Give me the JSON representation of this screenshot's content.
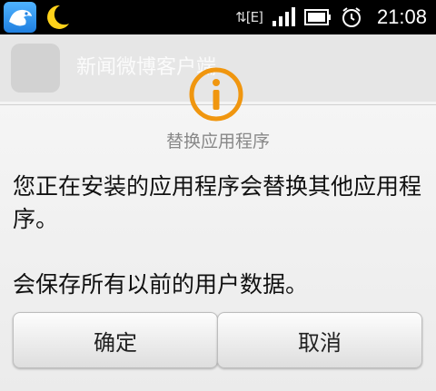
{
  "status_bar": {
    "network_label": "E",
    "time": "21:08",
    "icons": [
      "app-bird-icon",
      "moon-icon",
      "data-arrows-icon",
      "signal-icon",
      "battery-icon",
      "alarm-icon"
    ]
  },
  "background": {
    "app_label": "新闻微博客户端"
  },
  "dialog": {
    "icon": "info-icon",
    "title": "替换应用程序",
    "message_line1": "您正在安装的应用程序会替换其他应用程序。",
    "message_line2": "会保存所有以前的用户数据。",
    "ok_label": "确定",
    "cancel_label": "取消",
    "accent_color": "#f0960f"
  }
}
